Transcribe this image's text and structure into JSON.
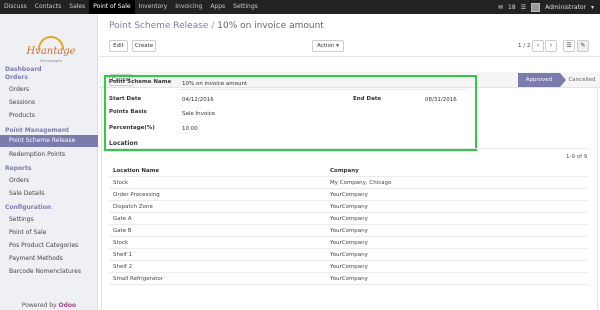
{
  "topbar": {
    "menu": [
      "Discuss",
      "Contacts",
      "Sales",
      "Point of Sale",
      "Inventory",
      "Invoicing",
      "Apps",
      "Settings"
    ],
    "active_menu": "Point of Sale",
    "messages_count": "18",
    "user": "Administrator"
  },
  "sidebar": {
    "logo_text": "Hvantage",
    "logo_tagline": "Technologies",
    "sections": [
      {
        "title": "Dashboard"
      },
      {
        "title": "Orders",
        "items": [
          "Orders",
          "Sessions",
          "Products"
        ]
      },
      {
        "title": "Point Management",
        "items": [
          "Point Scheme Release",
          "Redemption Points"
        ]
      },
      {
        "title": "Reports",
        "items": [
          "Orders",
          "Sale Details"
        ]
      },
      {
        "title": "Configuration",
        "items": [
          "Settings",
          "Point of Sale",
          "Pos Product Categories",
          "Payment Methods",
          "Barcode Nomenclatures"
        ]
      }
    ],
    "active_item": "Point Scheme Release",
    "powered_by": "Powered by",
    "powered_brand": "Odoo"
  },
  "breadcrumb": {
    "parent": "Point Scheme Release",
    "separator": "/",
    "current": "10% on invoice amount"
  },
  "toolbar": {
    "edit": "Edit",
    "create": "Create",
    "action": "Action ▾",
    "pager": "1 / 2",
    "prev": "‹",
    "next": "›"
  },
  "status": {
    "cancel_button": "Cancel",
    "approved": "Approved",
    "cancelled": "Cancelled"
  },
  "form": {
    "name_label": "Point Scheme Name",
    "name_value": "10% on invoice amount",
    "start_label": "Start Date",
    "start_value": "04/12/2016",
    "end_label": "End Date",
    "end_value": "08/31/2016",
    "basis_label": "Points Basis",
    "basis_value": "Sale Invoice",
    "percentage_label": "Percentage(%)",
    "percentage_value": "10.00"
  },
  "location": {
    "title": "Location",
    "count": "1-9 of 9",
    "headers": [
      "Location Name",
      "Company"
    ],
    "rows": [
      [
        "Stock",
        "My Company, Chicago"
      ],
      [
        "Order Processing",
        "YourCompany"
      ],
      [
        "Dispatch Zone",
        "YourCompany"
      ],
      [
        "Gate A",
        "YourCompany"
      ],
      [
        "Gate B",
        "YourCompany"
      ],
      [
        "Stock",
        "YourCompany"
      ],
      [
        "Shelf 1",
        "YourCompany"
      ],
      [
        "Shelf 2",
        "YourCompany"
      ],
      [
        "Small Refrigerator",
        "YourCompany"
      ]
    ]
  }
}
